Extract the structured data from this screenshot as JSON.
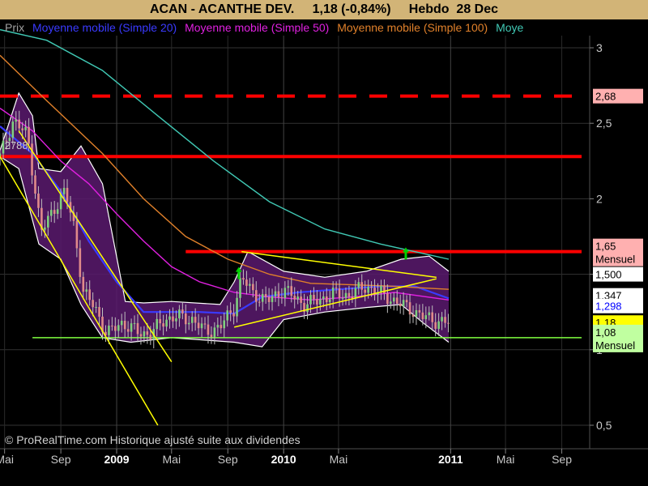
{
  "header": {
    "title": "ACAN - ACANTHE DEV.     1,18 (-0,84%)     Hebdo  28 Dec"
  },
  "legend": [
    {
      "label": "Prix",
      "color": "#a0a0a0"
    },
    {
      "label": "Moyenne mobile (Simple 20)",
      "color": "#3a3aff"
    },
    {
      "label": "Moyenne mobile (Simple 50)",
      "color": "#e020e0"
    },
    {
      "label": "Moyenne mobile (Simple 100)",
      "color": "#e0802a"
    },
    {
      "label": "Moye",
      "color": "#40c8b4"
    }
  ],
  "footer": {
    "copyright": "© ProRealTime.com Historique ajusté suite aux dividendes"
  },
  "chart_data": {
    "type": "line",
    "title": "ACAN - ACANTHE DEV.     1,18 (-0,84%)     Hebdo  28 Dec",
    "y_axis": {
      "ticks": [
        {
          "value": 0.5,
          "label": "0,5"
        },
        {
          "value": 1.0,
          "label": "1"
        },
        {
          "value": 1.5,
          "label": "1,5"
        },
        {
          "value": 2.0,
          "label": "2"
        },
        {
          "value": 2.5,
          "label": "2,5"
        },
        {
          "value": 3.0,
          "label": "3"
        }
      ],
      "position": "right",
      "range": [
        0.5,
        3.0
      ]
    },
    "x_axis": {
      "range": [
        "2008-04-21",
        "2011-11-01"
      ],
      "ticks": [
        {
          "date": "2008-05-01",
          "label": "Mai",
          "major": false
        },
        {
          "date": "2008-09-01",
          "label": "Sep",
          "major": false
        },
        {
          "date": "2009-01-01",
          "label": "2009",
          "major": true
        },
        {
          "date": "2009-05-01",
          "label": "Mai",
          "major": false
        },
        {
          "date": "2009-09-01",
          "label": "Sep",
          "major": false
        },
        {
          "date": "2010-01-01",
          "label": "2010",
          "major": true
        },
        {
          "date": "2010-05-01",
          "label": "Mai",
          "major": false
        },
        {
          "date": "2011-01-01",
          "label": "2011",
          "major": true
        },
        {
          "date": "2011-05-01",
          "label": "Mai",
          "major": false
        },
        {
          "date": "2011-09-01",
          "label": "Sep",
          "major": false
        }
      ]
    },
    "grid": true,
    "price_series": [
      {
        "date": "2008-04-21",
        "value": 2.28
      },
      {
        "date": "2008-05-20",
        "value": 2.52
      },
      {
        "date": "2008-06-20",
        "value": 2.42
      },
      {
        "date": "2008-07-05",
        "value": 2.1
      },
      {
        "date": "2008-07-20",
        "value": 1.78
      },
      {
        "date": "2008-08-20",
        "value": 1.95
      },
      {
        "date": "2008-09-10",
        "value": 2.05
      },
      {
        "date": "2008-10-01",
        "value": 1.8
      },
      {
        "date": "2008-10-20",
        "value": 1.38
      },
      {
        "date": "2008-11-15",
        "value": 1.28
      },
      {
        "date": "2008-12-10",
        "value": 1.1
      },
      {
        "date": "2009-01-10",
        "value": 1.18
      },
      {
        "date": "2009-02-15",
        "value": 1.12
      },
      {
        "date": "2009-03-15",
        "value": 1.1
      },
      {
        "date": "2009-04-15",
        "value": 1.2
      },
      {
        "date": "2009-05-15",
        "value": 1.22
      },
      {
        "date": "2009-06-15",
        "value": 1.2
      },
      {
        "date": "2009-07-15",
        "value": 1.12
      },
      {
        "date": "2009-08-15",
        "value": 1.15
      },
      {
        "date": "2009-09-15",
        "value": 1.28
      },
      {
        "date": "2009-10-01",
        "value": 1.48
      },
      {
        "date": "2009-10-25",
        "value": 1.38
      },
      {
        "date": "2009-11-25",
        "value": 1.32
      },
      {
        "date": "2010-01-01",
        "value": 1.4
      },
      {
        "date": "2010-02-15",
        "value": 1.3
      },
      {
        "date": "2010-03-20",
        "value": 1.33
      },
      {
        "date": "2010-04-20",
        "value": 1.37
      },
      {
        "date": "2010-05-20",
        "value": 1.36
      },
      {
        "date": "2010-07-01",
        "value": 1.42
      },
      {
        "date": "2010-08-15",
        "value": 1.35
      },
      {
        "date": "2010-09-15",
        "value": 1.3
      },
      {
        "date": "2010-10-10",
        "value": 1.26
      },
      {
        "date": "2010-11-01",
        "value": 1.22
      },
      {
        "date": "2010-12-01",
        "value": 1.19
      },
      {
        "date": "2010-12-28",
        "value": 1.18
      }
    ],
    "bollinger_upper": [
      {
        "date": "2008-04-21",
        "value": 2.32
      },
      {
        "date": "2008-06-01",
        "value": 2.7
      },
      {
        "date": "2008-07-01",
        "value": 2.55
      },
      {
        "date": "2008-07-15",
        "value": 2.2
      },
      {
        "date": "2008-09-01",
        "value": 2.18
      },
      {
        "date": "2008-10-15",
        "value": 2.35
      },
      {
        "date": "2008-12-01",
        "value": 2.1
      },
      {
        "date": "2009-01-20",
        "value": 1.32
      },
      {
        "date": "2009-03-01",
        "value": 1.31
      },
      {
        "date": "2009-05-01",
        "value": 1.32
      },
      {
        "date": "2009-08-15",
        "value": 1.3
      },
      {
        "date": "2009-09-15",
        "value": 1.45
      },
      {
        "date": "2009-10-15",
        "value": 1.65
      },
      {
        "date": "2010-01-01",
        "value": 1.52
      },
      {
        "date": "2010-04-01",
        "value": 1.48
      },
      {
        "date": "2010-07-01",
        "value": 1.52
      },
      {
        "date": "2010-09-15",
        "value": 1.6
      },
      {
        "date": "2010-11-15",
        "value": 1.62
      },
      {
        "date": "2010-12-28",
        "value": 1.52
      }
    ],
    "bollinger_lower": [
      {
        "date": "2008-04-21",
        "value": 2.28
      },
      {
        "date": "2008-06-01",
        "value": 2.2
      },
      {
        "date": "2008-07-15",
        "value": 1.7
      },
      {
        "date": "2008-09-01",
        "value": 1.6
      },
      {
        "date": "2008-10-15",
        "value": 1.3
      },
      {
        "date": "2008-12-01",
        "value": 1.08
      },
      {
        "date": "2009-02-01",
        "value": 1.05
      },
      {
        "date": "2009-05-01",
        "value": 1.08
      },
      {
        "date": "2009-08-01",
        "value": 1.06
      },
      {
        "date": "2009-09-15",
        "value": 1.05
      },
      {
        "date": "2009-11-15",
        "value": 1.02
      },
      {
        "date": "2010-01-01",
        "value": 1.2
      },
      {
        "date": "2010-04-01",
        "value": 1.25
      },
      {
        "date": "2010-07-01",
        "value": 1.28
      },
      {
        "date": "2010-09-15",
        "value": 1.3
      },
      {
        "date": "2010-11-01",
        "value": 1.18
      },
      {
        "date": "2010-12-28",
        "value": 1.05
      }
    ],
    "moving_averages": [
      {
        "name": "Moyenne mobile (Simple 20)",
        "color": "#3a3aff",
        "points": [
          {
            "date": "2008-04-21",
            "value": 2.48
          },
          {
            "date": "2008-07-01",
            "value": 2.3
          },
          {
            "date": "2008-09-01",
            "value": 2.05
          },
          {
            "date": "2008-11-01",
            "value": 1.72
          },
          {
            "date": "2009-01-01",
            "value": 1.45
          },
          {
            "date": "2009-03-01",
            "value": 1.25
          },
          {
            "date": "2009-05-01",
            "value": 1.25
          },
          {
            "date": "2009-07-01",
            "value": 1.25
          },
          {
            "date": "2009-09-15",
            "value": 1.24
          },
          {
            "date": "2009-11-15",
            "value": 1.35
          },
          {
            "date": "2010-02-01",
            "value": 1.38
          },
          {
            "date": "2010-05-01",
            "value": 1.4
          },
          {
            "date": "2010-08-01",
            "value": 1.42
          },
          {
            "date": "2010-10-15",
            "value": 1.42
          },
          {
            "date": "2010-12-28",
            "value": 1.34
          }
        ]
      },
      {
        "name": "Moyenne mobile (Simple 50)",
        "color": "#e020e0",
        "points": [
          {
            "date": "2008-04-21",
            "value": 2.6
          },
          {
            "date": "2008-07-01",
            "value": 2.45
          },
          {
            "date": "2008-09-01",
            "value": 2.25
          },
          {
            "date": "2008-11-01",
            "value": 2.1
          },
          {
            "date": "2009-01-01",
            "value": 1.9
          },
          {
            "date": "2009-03-01",
            "value": 1.72
          },
          {
            "date": "2009-05-01",
            "value": 1.55
          },
          {
            "date": "2009-07-01",
            "value": 1.45
          },
          {
            "date": "2009-09-15",
            "value": 1.38
          },
          {
            "date": "2009-12-01",
            "value": 1.35
          },
          {
            "date": "2010-03-01",
            "value": 1.33
          },
          {
            "date": "2010-06-01",
            "value": 1.35
          },
          {
            "date": "2010-09-01",
            "value": 1.38
          },
          {
            "date": "2010-12-28",
            "value": 1.33
          }
        ]
      },
      {
        "name": "Moyenne mobile (Simple 100)",
        "color": "#e0802a",
        "points": [
          {
            "date": "2008-04-21",
            "value": 2.95
          },
          {
            "date": "2008-08-01",
            "value": 2.65
          },
          {
            "date": "2008-12-01",
            "value": 2.3
          },
          {
            "date": "2009-03-01",
            "value": 2.0
          },
          {
            "date": "2009-06-01",
            "value": 1.75
          },
          {
            "date": "2009-09-01",
            "value": 1.6
          },
          {
            "date": "2009-12-01",
            "value": 1.5
          },
          {
            "date": "2010-03-01",
            "value": 1.44
          },
          {
            "date": "2010-06-01",
            "value": 1.43
          },
          {
            "date": "2010-09-01",
            "value": 1.42
          },
          {
            "date": "2010-12-28",
            "value": 1.4
          }
        ]
      },
      {
        "name": "Moye",
        "color": "#40c8b4",
        "points": [
          {
            "date": "2008-04-21",
            "value": 3.12
          },
          {
            "date": "2008-08-01",
            "value": 3.05
          },
          {
            "date": "2008-12-01",
            "value": 2.85
          },
          {
            "date": "2009-04-01",
            "value": 2.55
          },
          {
            "date": "2009-08-01",
            "value": 2.25
          },
          {
            "date": "2009-12-01",
            "value": 1.98
          },
          {
            "date": "2010-04-01",
            "value": 1.8
          },
          {
            "date": "2010-08-01",
            "value": 1.7
          },
          {
            "date": "2010-12-28",
            "value": 1.6
          }
        ]
      }
    ],
    "horizontal_lines": [
      {
        "value": 2.68,
        "color": "#ff0000",
        "style": "dashed",
        "from": "2008-04-21",
        "to": "2011-11-01"
      },
      {
        "value": 2.28,
        "color": "#ff0000",
        "style": "solid",
        "from": "2008-04-21",
        "to": "2011-11-01"
      },
      {
        "value": 1.65,
        "color": "#ff0000",
        "style": "solid",
        "from": "2009-06-01",
        "to": "2011-11-01"
      },
      {
        "value": 1.08,
        "color": "#80ff40",
        "style": "solid",
        "from": "2008-07-01",
        "to": "2011-11-01"
      }
    ],
    "trendlines": [
      {
        "color": "#ffff00",
        "from": {
          "date": "2008-04-21",
          "value": 2.28
        },
        "to": {
          "date": "2009-04-01",
          "value": 0.5
        }
      },
      {
        "color": "#ffff00",
        "from": {
          "date": "2008-06-01",
          "value": 2.45
        },
        "to": {
          "date": "2009-05-01",
          "value": 0.92
        }
      },
      {
        "color": "#ffff00",
        "from": {
          "date": "2009-10-01",
          "value": 1.65
        },
        "to": {
          "date": "2010-12-01",
          "value": 1.48
        }
      },
      {
        "color": "#ffff00",
        "from": {
          "date": "2009-09-15",
          "value": 1.15
        },
        "to": {
          "date": "2010-12-01",
          "value": 1.47
        }
      }
    ],
    "markers": [
      {
        "date": "2009-09-25",
        "value": 1.5,
        "color": "#00d000",
        "shape": "up-arrow"
      },
      {
        "date": "2010-09-25",
        "value": 1.63,
        "color": "#00d000",
        "shape": "up-arrow"
      }
    ],
    "inline_labels": [
      {
        "date": "2008-05-01",
        "value": 2.33,
        "text": "2788"
      }
    ],
    "price_tags": [
      {
        "value": 2.68,
        "label": "2,68",
        "bg": "#ffb0b0",
        "fg": "#000000"
      },
      {
        "value": 1.65,
        "label": "1,65",
        "label2": "Mensuel",
        "bg": "#ffb0b0",
        "fg": "#000000"
      },
      {
        "value": 1.5,
        "label": "1,500",
        "bg": "#ffffff",
        "fg": "#000000"
      },
      {
        "value": 1.36,
        "label": "1,347",
        "bg": "#ffffff",
        "fg": "#000000"
      },
      {
        "value": 1.29,
        "label": "1,298",
        "bg": "#ffffff",
        "fg": "#0000ff"
      },
      {
        "value": 1.18,
        "label": "1,18",
        "bg": "#ffff00",
        "fg": "#000000"
      },
      {
        "value": 1.08,
        "label": "1,08",
        "label2": "Mensuel",
        "bg": "#c0ffa0",
        "fg": "#000000"
      }
    ]
  }
}
